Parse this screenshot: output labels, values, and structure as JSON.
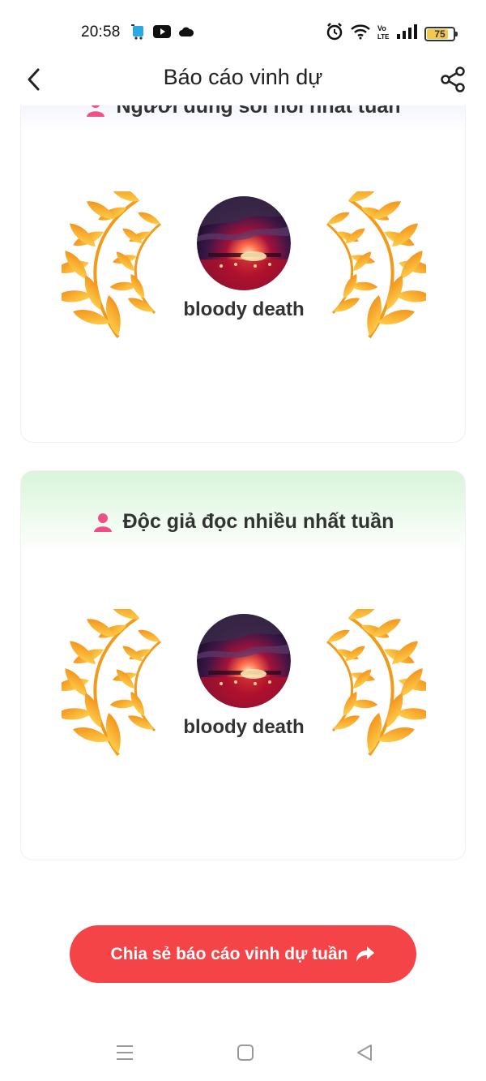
{
  "status_bar": {
    "time": "20:58",
    "battery_level": "75",
    "icons": [
      "app-notification-icon",
      "youtube-icon",
      "cloud-icon",
      "alarm-icon",
      "wifi-icon",
      "volte-icon",
      "signal-icon",
      "battery-icon"
    ]
  },
  "header": {
    "title": "Báo cáo vinh dự",
    "back_icon": "chevron-left-icon",
    "share_icon": "share-icon"
  },
  "cards": [
    {
      "title": "Người dùng sôi nổi nhất tuần",
      "username": "bloody death"
    },
    {
      "title": "Độc giả đọc nhiều nhất tuần",
      "username": "bloody death"
    }
  ],
  "share_button": {
    "label": "Chia sẻ báo cáo vinh dự tuần",
    "icon": "forward-arrow-icon"
  },
  "nav_bar": {
    "buttons": [
      "menu-icon",
      "home-icon",
      "back-triangle-icon"
    ]
  },
  "colors": {
    "accent": "#f44447",
    "laurel_gold": "#f9b21c",
    "laurel_orange": "#f07b16",
    "person_icon_pink": "#ee4f86"
  }
}
